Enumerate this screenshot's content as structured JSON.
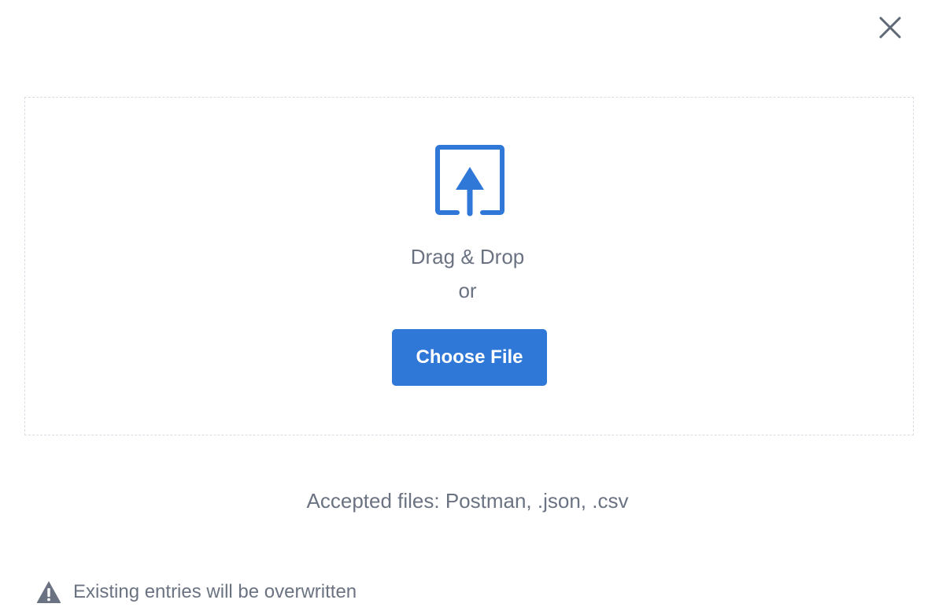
{
  "dialog": {
    "close_icon": "close-icon",
    "upload_icon": "upload-icon",
    "drag_text": "Drag & Drop",
    "or_text": "or",
    "choose_button_label": "Choose File",
    "accepted_text": "Accepted files: Postman, .json, .csv",
    "warning_icon": "warning-icon",
    "warning_text": "Existing entries will be overwritten"
  },
  "colors": {
    "accent": "#2f78d8",
    "text_muted": "#6b7382",
    "close_icon": "#5f6877",
    "warning_icon": "#6b7382",
    "dropzone_border": "#d9dde3"
  }
}
